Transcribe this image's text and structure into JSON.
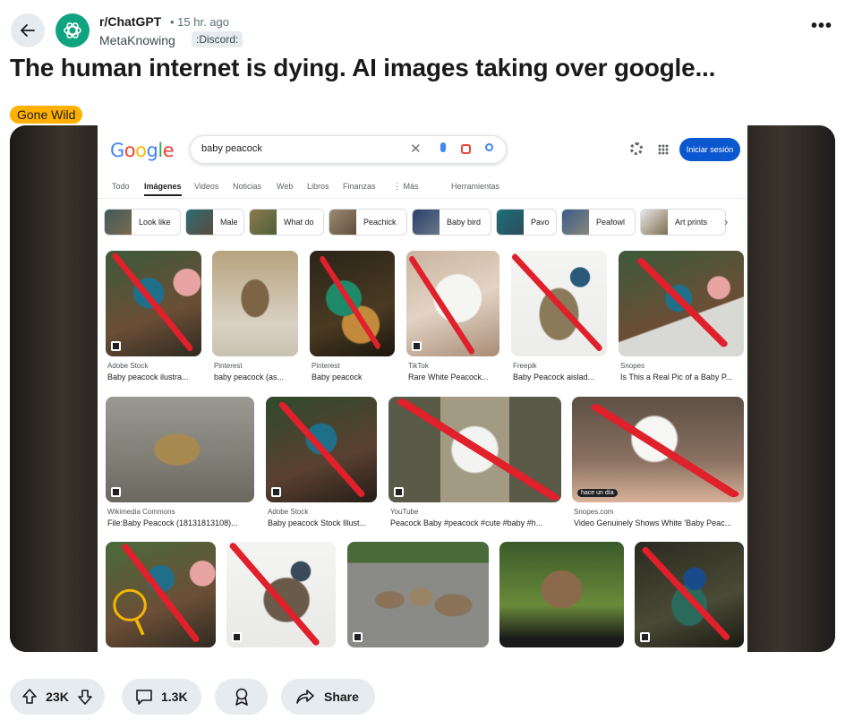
{
  "post": {
    "subreddit": "r/ChatGPT",
    "age": "• 15 hr. ago",
    "author": "MetaKnowing",
    "author_flair": ":Discord:",
    "title": "The human internet is dying. AI images taking over google...",
    "flair": "Gone Wild"
  },
  "google": {
    "logo": "Google",
    "query": "baby peacock",
    "signin": "Iniciar sesión",
    "tabs": [
      "Todo",
      "Imágenes",
      "Videos",
      "Noticias",
      "Web",
      "Libros",
      "Finanzas",
      "⋮ Más",
      "Herramientas"
    ],
    "chips": [
      "Look like",
      "Male",
      "What do",
      "Peachick",
      "Baby bird",
      "Pavo",
      "Peafowl",
      "Art prints"
    ],
    "results_row1": [
      {
        "source": "Adobe Stock",
        "caption": "Baby peacock ilustra..."
      },
      {
        "source": "Pinterest",
        "caption": "baby peacock (as..."
      },
      {
        "source": "Pinterest",
        "caption": "Baby peacock"
      },
      {
        "source": "TikTok",
        "caption": "Rare White Peacock..."
      },
      {
        "source": "Freepik",
        "caption": "Baby Peacock aislad..."
      },
      {
        "source": "Snopes",
        "caption": "Is This a Real Pic of a Baby P..."
      }
    ],
    "results_row2": [
      {
        "source": "Wikimedia Commons",
        "caption": "File:Baby Peacock (18131813108)..."
      },
      {
        "source": "Adobe Stock",
        "caption": "Baby peacock Stock Illust..."
      },
      {
        "source": "YouTube",
        "caption": "Peacock Baby #peacock #cute #baby #h..."
      },
      {
        "source": "Snopes.com",
        "caption": "Video Genuinely Shows White 'Baby Peac..."
      }
    ],
    "video_badge": "hace un día"
  },
  "actions": {
    "upvotes": "23K",
    "comments": "1.3K",
    "share": "Share"
  },
  "colors": {
    "brand": "#10a37f",
    "flair_bg": "#ffb000",
    "pill_bg": "#e5ebee",
    "strike": "#e0202a"
  }
}
